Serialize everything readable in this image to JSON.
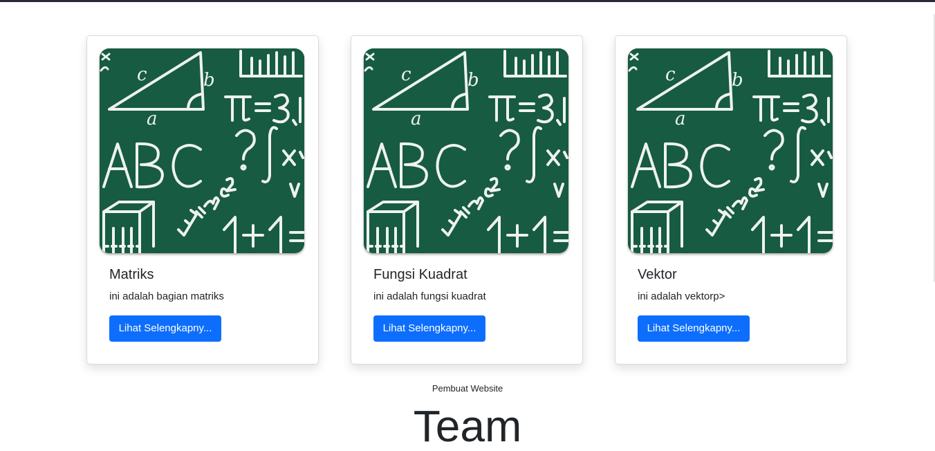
{
  "cards": [
    {
      "title": "Matriks",
      "description": "ini adalah bagian matriks",
      "button_label": "Lihat Selengkapny...",
      "image_icon": "math-chalkboard-image"
    },
    {
      "title": "Fungsi Kuadrat",
      "description": "ini adalah fungsi kuadrat",
      "button_label": "Lihat Selengkapny...",
      "image_icon": "math-chalkboard-image"
    },
    {
      "title": "Vektor",
      "description": "ini adalah vektorp>",
      "button_label": "Lihat Selengkapny...",
      "image_icon": "math-chalkboard-image"
    }
  ],
  "team_section": {
    "label": "Pembuat Website",
    "heading": "Team"
  },
  "colors": {
    "primary_button": "#0d6efd",
    "chalkboard": "#175b42",
    "top_bar": "#262a33"
  }
}
